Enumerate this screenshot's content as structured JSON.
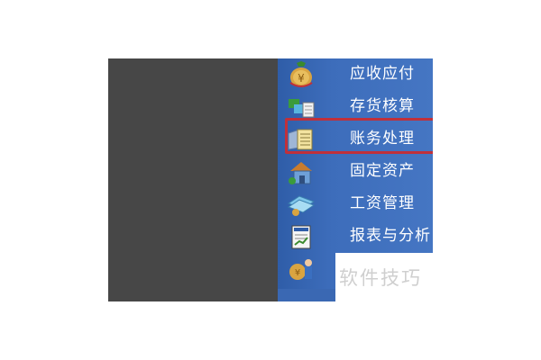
{
  "menu": {
    "items": [
      {
        "label": "应收应付",
        "icon": "money-bag-icon"
      },
      {
        "label": "存货核算",
        "icon": "inventory-icon"
      },
      {
        "label": "账务处理",
        "icon": "ledger-icon",
        "highlighted": true
      },
      {
        "label": "固定资产",
        "icon": "house-asset-icon"
      },
      {
        "label": "工资管理",
        "icon": "salary-icon"
      },
      {
        "label": "报表与分析",
        "icon": "report-icon"
      },
      {
        "label": "",
        "icon": "person-money-icon"
      }
    ]
  },
  "watermark": {
    "text": "软件技巧"
  },
  "colors": {
    "dark_area": "#474747",
    "menu_blue": "#3f6fb6",
    "highlight": "#c0303a"
  }
}
